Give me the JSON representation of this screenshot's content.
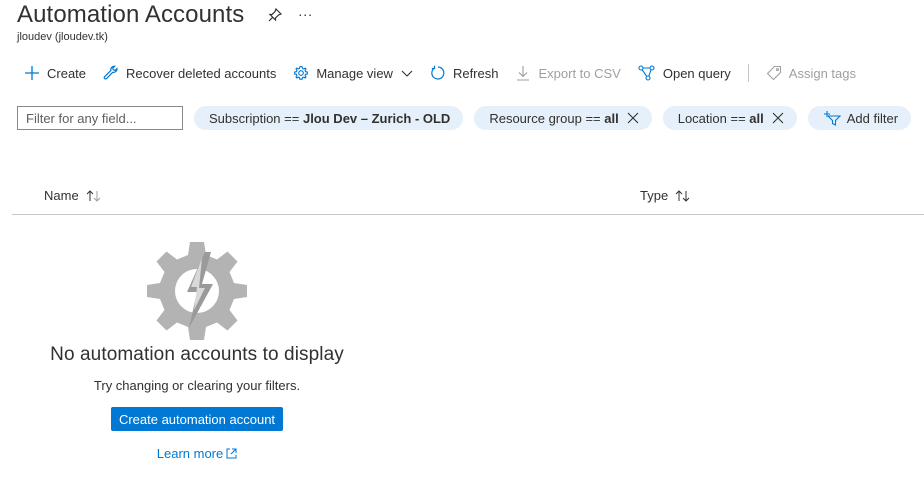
{
  "header": {
    "title": "Automation Accounts",
    "subtitle": "jloudev (jloudev.tk)",
    "more_label": "..."
  },
  "toolbar": {
    "create": "Create",
    "recover": "Recover deleted accounts",
    "manage_view": "Manage view",
    "refresh": "Refresh",
    "export_csv": "Export to CSV",
    "open_query": "Open query",
    "assign_tags": "Assign tags"
  },
  "filters": {
    "placeholder": "Filter for any field...",
    "subscription": {
      "key": "Subscription ==",
      "value": "Jlou Dev – Zurich - OLD"
    },
    "resource_group": {
      "key": "Resource group ==",
      "value": "all"
    },
    "location": {
      "key": "Location ==",
      "value": "all"
    },
    "add_filter": "Add filter"
  },
  "grid": {
    "columns": [
      "Name",
      "Type"
    ]
  },
  "empty_state": {
    "title": "No automation accounts to display",
    "text": "Try changing or clearing your filters.",
    "create_button": "Create automation account",
    "learn_more": "Learn more"
  },
  "colors": {
    "accent": "#0078d4",
    "pill_bg": "#e5f0fa",
    "disabled": "#a19f9d"
  }
}
